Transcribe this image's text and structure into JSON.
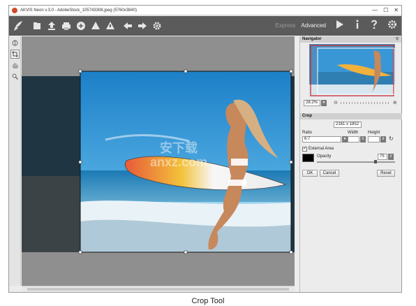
{
  "window": {
    "title": "AKVIS Neon v.3.0 - AdobeStock_105743308.jpeg (5760x3840)",
    "controls": [
      "—",
      "☐",
      "✕"
    ]
  },
  "toolbar": {
    "icons": [
      "home-icon",
      "open-icon",
      "save-icon",
      "print-icon",
      "share-icon",
      "batch-icon",
      "settings-icon",
      "undo-icon",
      "redo-icon",
      "gear-icon"
    ],
    "modes": {
      "express": "Express",
      "advanced": "Advanced"
    }
  },
  "navigator": {
    "title": "Navigator",
    "zoom": "28.2%"
  },
  "crop": {
    "title": "Crop",
    "size": "2161 x 1852",
    "ratio_label": "Ratio",
    "ratio_value": "6:7",
    "width_label": "Width",
    "height_label": "Height",
    "external_area_label": "External Area",
    "external_area_checked": true,
    "opacity_label": "Opacity",
    "opacity_value": "75",
    "ok_label": "OK",
    "cancel_label": "Cancel",
    "reset_label": "Reset"
  },
  "watermark": "安下载\nanxz.com",
  "caption": "Crop Tool",
  "colors": {
    "toolbar": "#5b5b5b",
    "canvas": "#8f8f8f",
    "accent": "#d24a2a"
  }
}
